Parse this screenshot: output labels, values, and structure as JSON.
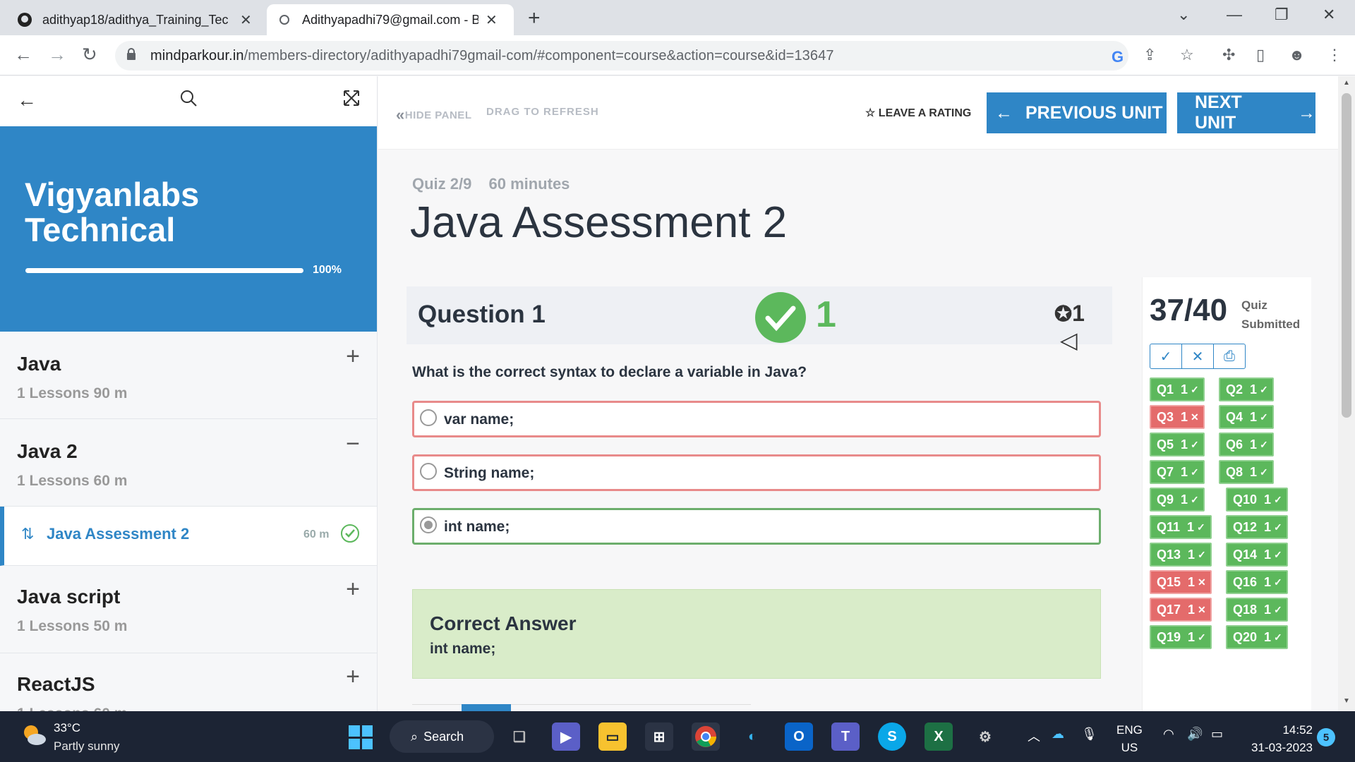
{
  "browser": {
    "tabs": [
      {
        "title": "adithyap18/adithya_Training_Tec",
        "icon": "github-icon"
      },
      {
        "title": "Adithyapadhi79@gmail.com - Be",
        "icon": "site-icon"
      }
    ],
    "url_host": "mindparkour.in",
    "url_path": "/members-directory/adithyapadhi79gmail-com/#component=course&action=course&id=13647"
  },
  "sidebar": {
    "course_title": "Vigyanlabs Technical",
    "progress_label": "100%",
    "progress": 1.0,
    "sections": [
      {
        "title": "Java",
        "meta": "1 Lessons  90 m",
        "toggle": "+"
      },
      {
        "title": "Java 2",
        "meta": "1 Lessons  60 m",
        "toggle": "−"
      },
      {
        "title": "Java script",
        "meta": "1 Lessons  50 m",
        "toggle": "+"
      },
      {
        "title": "ReactJS",
        "meta": "1 Lessons  60 m",
        "toggle": "+"
      }
    ],
    "active_lesson": {
      "title": "Java Assessment 2",
      "duration": "60 m"
    }
  },
  "topbar": {
    "hide_panel": "HIDE PANEL",
    "drag_refresh": "DRAG TO REFRESH",
    "rating": "LEAVE A RATING",
    "prev": "PREVIOUS UNIT",
    "next": "NEXT UNIT"
  },
  "quiz": {
    "meta_count": "Quiz 2/9",
    "meta_time": "60 minutes",
    "title": "Java Assessment 2",
    "question_label": "Question 1",
    "question_score": "1",
    "points": "1",
    "question_text": "What is the correct syntax to declare a variable in Java?",
    "options": [
      {
        "text": "var name;",
        "state": "wrong",
        "selected": false
      },
      {
        "text": "String name;",
        "state": "wrong",
        "selected": false
      },
      {
        "text": "int name;",
        "state": "correct",
        "selected": true
      }
    ],
    "answer_heading": "Correct Answer",
    "answer_text": "int name;"
  },
  "results": {
    "score": "37/40",
    "status_line1": "Quiz",
    "status_line2": "Submitted",
    "questions": [
      {
        "label": "Q1",
        "pts": "1",
        "ok": true
      },
      {
        "label": "Q2",
        "pts": "1",
        "ok": true
      },
      {
        "label": "Q3",
        "pts": "1",
        "ok": false
      },
      {
        "label": "Q4",
        "pts": "1",
        "ok": true
      },
      {
        "label": "Q5",
        "pts": "1",
        "ok": true
      },
      {
        "label": "Q6",
        "pts": "1",
        "ok": true
      },
      {
        "label": "Q7",
        "pts": "1",
        "ok": true
      },
      {
        "label": "Q8",
        "pts": "1",
        "ok": true
      },
      {
        "label": "Q9",
        "pts": "1",
        "ok": true
      },
      {
        "label": "Q10",
        "pts": "1",
        "ok": true
      },
      {
        "label": "Q11",
        "pts": "1",
        "ok": true
      },
      {
        "label": "Q12",
        "pts": "1",
        "ok": true
      },
      {
        "label": "Q13",
        "pts": "1",
        "ok": true
      },
      {
        "label": "Q14",
        "pts": "1",
        "ok": true
      },
      {
        "label": "Q15",
        "pts": "1",
        "ok": false
      },
      {
        "label": "Q16",
        "pts": "1",
        "ok": true
      },
      {
        "label": "Q17",
        "pts": "1",
        "ok": false
      },
      {
        "label": "Q18",
        "pts": "1",
        "ok": true
      },
      {
        "label": "Q19",
        "pts": "1",
        "ok": true
      },
      {
        "label": "Q20",
        "pts": "1",
        "ok": true
      }
    ]
  },
  "taskbar": {
    "temp": "33°C",
    "condition": "Partly sunny",
    "search": "Search",
    "lang1": "ENG",
    "lang2": "US",
    "time": "14:52",
    "date": "31-03-2023",
    "badge": "5"
  },
  "colors": {
    "accent": "#2f86c6",
    "correct": "#5cb85c",
    "wrong": "#e46b6b"
  }
}
